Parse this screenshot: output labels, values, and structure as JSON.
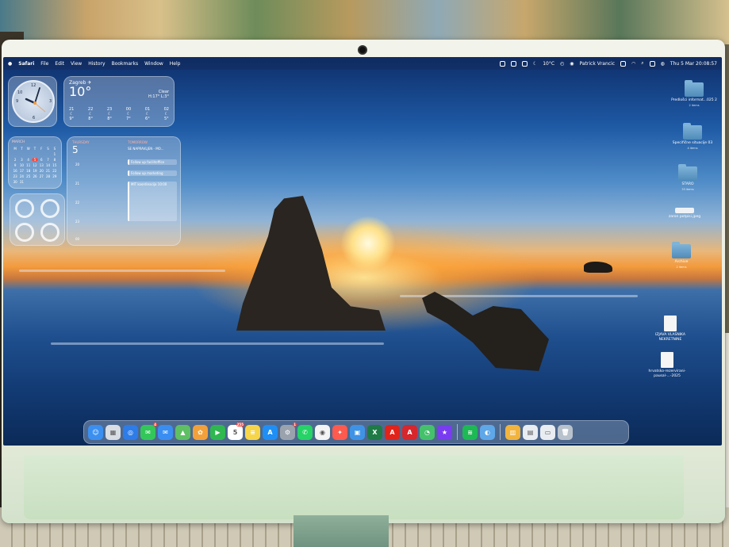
{
  "menubar": {
    "apple": "",
    "app_name": "Safari",
    "menus": [
      "File",
      "Edit",
      "View",
      "History",
      "Bookmarks",
      "Window",
      "Help"
    ],
    "weather": "10°C",
    "user": "Patrick Vrancic",
    "datetime": "Thu 5 Mar 20:08:57"
  },
  "widgets": {
    "clock": {
      "n12": "12",
      "n3": "3",
      "n6": "6",
      "n9": "9",
      "n10": "10"
    },
    "weather": {
      "city": "Zagreb ✈",
      "temp": "10°",
      "condition": "Clear",
      "hilo": "H:17° L:3°",
      "hours": [
        "21",
        "22",
        "23",
        "00",
        "01",
        "02"
      ],
      "temps": [
        "9°",
        "8°",
        "8°",
        "7°",
        "6°",
        "5°"
      ]
    },
    "calendar": {
      "month": "MARCH",
      "weekdays": [
        "M",
        "T",
        "W",
        "T",
        "F",
        "S",
        "S"
      ],
      "days": [
        "",
        "",
        "",
        "",
        "",
        "",
        "1",
        "2",
        "3",
        "4",
        "5",
        "6",
        "7",
        "8",
        "9",
        "10",
        "11",
        "12",
        "13",
        "14",
        "15",
        "16",
        "17",
        "18",
        "19",
        "20",
        "21",
        "22",
        "23",
        "24",
        "25",
        "26",
        "27",
        "28",
        "29",
        "30",
        "31"
      ]
    },
    "upnext": {
      "day_label": "THURSDAY",
      "day_num": "5",
      "tomorrow_label": "TOMORROW",
      "first_event": "SE NAPRAVLJEN - MO...",
      "events": [
        "Follow up facilitoffice",
        "Follow up marketing",
        "MIT koordinacija 10:00"
      ],
      "hours": [
        "20",
        "21",
        "22",
        "23",
        "00"
      ]
    }
  },
  "desktop_icons": [
    {
      "name": "Predlošci informat...025 2",
      "sub": "2 items",
      "type": "folder"
    },
    {
      "name": "Specifične situacije 03",
      "sub": "4 items",
      "type": "folder"
    },
    {
      "name": "STARO",
      "sub": "33 items",
      "type": "folder"
    },
    {
      "name": "zaron potpisi.jpeg",
      "sub": "",
      "type": "image"
    },
    {
      "name": "Archive",
      "sub": "2 items",
      "type": "folder"
    },
    {
      "name": "IZJAVA VLASNIKA NEKRETNINE",
      "sub": "",
      "type": "doc"
    },
    {
      "name": "hrvatsko-rezervirani-pausal-...-2025",
      "sub": "",
      "type": "doc"
    }
  ],
  "dock": {
    "apps": [
      {
        "name": "Finder",
        "color": "#3b8ff0",
        "glyph": "☺"
      },
      {
        "name": "Launchpad",
        "color": "#d9dde4",
        "glyph": "▦"
      },
      {
        "name": "Safari",
        "color": "#2e7ce8",
        "glyph": "◎"
      },
      {
        "name": "Messages",
        "color": "#33c759",
        "glyph": "✉",
        "badge": "4"
      },
      {
        "name": "Mail",
        "color": "#3a8ef2",
        "glyph": "✉"
      },
      {
        "name": "Maps",
        "color": "#5fbf63",
        "glyph": "▲"
      },
      {
        "name": "Photos",
        "color": "#f2a13a",
        "glyph": "✿"
      },
      {
        "name": "FaceTime",
        "color": "#2fb84f",
        "glyph": "▶"
      },
      {
        "name": "Calendar",
        "color": "#ffffff",
        "glyph": "5",
        "badge": "255"
      },
      {
        "name": "Notes",
        "color": "#f7d548",
        "glyph": "≡"
      },
      {
        "name": "App Store",
        "color": "#1f8ff5",
        "glyph": "A"
      },
      {
        "name": "System Settings",
        "color": "#9aa3ad",
        "glyph": "⚙",
        "badge": "1"
      },
      {
        "name": "WhatsApp",
        "color": "#25d366",
        "glyph": "✆"
      },
      {
        "name": "Chrome",
        "color": "#f4f4f4",
        "glyph": "◉"
      },
      {
        "name": "Craft",
        "color": "#ff5a4e",
        "glyph": "✦"
      },
      {
        "name": "Preview",
        "color": "#3f93e6",
        "glyph": "▣"
      },
      {
        "name": "Excel",
        "color": "#1e7b45",
        "glyph": "X"
      },
      {
        "name": "Acrobat",
        "color": "#e2231a",
        "glyph": "A"
      },
      {
        "name": "Acrobat Reader",
        "color": "#d7262c",
        "glyph": "A"
      },
      {
        "name": "Phone Link",
        "color": "#45c16b",
        "glyph": "◔"
      },
      {
        "name": "iMovie",
        "color": "#7a3cf0",
        "glyph": "★"
      },
      {
        "name": "Spotify",
        "color": "#1db954",
        "glyph": "≋"
      },
      {
        "name": "Finder Recent",
        "color": "#5ea7e8",
        "glyph": "◐"
      },
      {
        "name": "Stacks",
        "color": "#f2b43c",
        "glyph": "▥"
      },
      {
        "name": "Documents",
        "color": "#e9edf2",
        "glyph": "▤"
      },
      {
        "name": "Downloads",
        "color": "#e9edf2",
        "glyph": "▭"
      },
      {
        "name": "Trash",
        "color": "#b8c2cc",
        "glyph": "🗑"
      }
    ]
  },
  "colors": {
    "accent": "#ff3b30",
    "bezel": "#eef0e6",
    "chin": "#d3e6cc"
  }
}
